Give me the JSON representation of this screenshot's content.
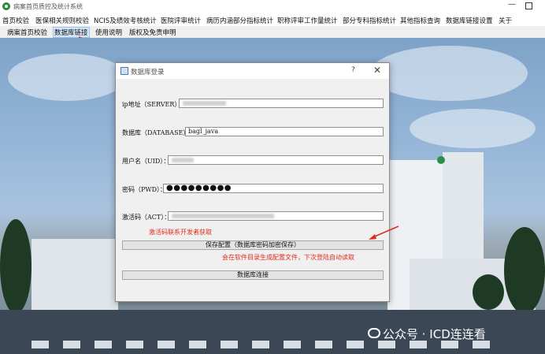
{
  "app": {
    "title": "病案首页质控及统计系统"
  },
  "menu": [
    "首页校验",
    "医保相关规则校验",
    "NCIS及绩效考核统计",
    "医院评审统计",
    "病历内涵部分指标统计",
    "职称评审工作量统计",
    "部分专科指标统计",
    "其他指标查询",
    "数据库链接设置",
    "关于"
  ],
  "toolbar": [
    "病案首页校验",
    "数据库链接",
    "使用说明",
    "版权及免责申明"
  ],
  "dialog": {
    "title": "数据库登录",
    "help": "?",
    "close": "✕",
    "ip_label": "ip地址（SERVER）：",
    "db_label": "数据库（DATABASE）：",
    "db_value": "bagl_java",
    "uid_label": "用户名（UID）：",
    "pwd_label": "密码（PWD）：",
    "pwd_value": "●●●●●●●●●",
    "act_label": "激活码（ACT）：",
    "act_note": "激活码联系开发者获取",
    "save_button": "保存配置（数据库密码加密保存）",
    "save_note": "会在软件目录生成配置文件，下次登陆自动读取",
    "connect_button": "数据库连接"
  },
  "watermark": "公众号 · ICD连连看",
  "colors": {
    "annotation_red": "#e22b1c",
    "selected_tab": "#d6e8fb"
  }
}
